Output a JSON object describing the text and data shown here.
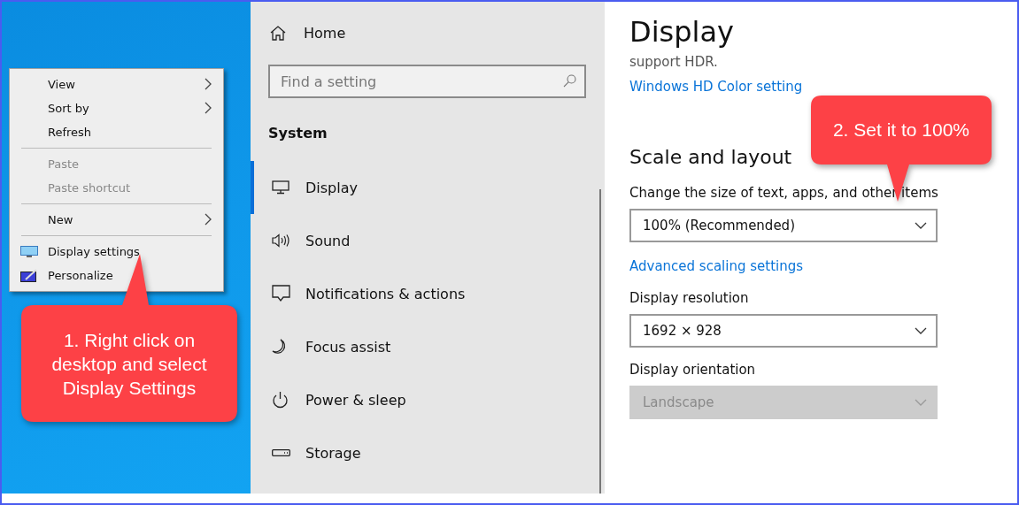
{
  "context_menu": {
    "items": [
      {
        "kind": "item",
        "label": "View",
        "submenu": true,
        "disabled": false
      },
      {
        "kind": "item",
        "label": "Sort by",
        "submenu": true,
        "disabled": false
      },
      {
        "kind": "item",
        "label": "Refresh",
        "submenu": false,
        "disabled": false
      },
      {
        "kind": "separator"
      },
      {
        "kind": "item",
        "label": "Paste",
        "submenu": false,
        "disabled": true
      },
      {
        "kind": "item",
        "label": "Paste shortcut",
        "submenu": false,
        "disabled": true
      },
      {
        "kind": "separator"
      },
      {
        "kind": "item",
        "label": "New",
        "submenu": true,
        "disabled": false
      },
      {
        "kind": "separator"
      },
      {
        "kind": "item",
        "label": "Display settings",
        "submenu": false,
        "disabled": false
      },
      {
        "kind": "item",
        "label": "Personalize",
        "submenu": false,
        "disabled": false
      }
    ]
  },
  "callouts": [
    {
      "text": "1. Right click on desktop and select Display Settings"
    },
    {
      "text": "2. Set it to 100%"
    }
  ],
  "sidebar": {
    "home": "Home",
    "search": {
      "placeholder": "Find a setting"
    },
    "section": "System",
    "items": [
      {
        "label": "Display",
        "selected": true
      },
      {
        "label": "Sound",
        "selected": false
      },
      {
        "label": "Notifications & actions",
        "selected": false
      },
      {
        "label": "Focus assist",
        "selected": false
      },
      {
        "label": "Power & sleep",
        "selected": false
      },
      {
        "label": "Storage",
        "selected": false
      }
    ]
  },
  "content": {
    "title": "Display",
    "hdr_note": "support HDR.",
    "hdr_link": "Windows HD Color setting",
    "section": "Scale and layout",
    "scale": {
      "label": "Change the size of text, apps, and other items",
      "value": "100% (Recommended)",
      "disabled": false
    },
    "advanced_link": "Advanced scaling settings",
    "resolution": {
      "label": "Display resolution",
      "value": "1692 × 928",
      "disabled": false
    },
    "orientation": {
      "label": "Display orientation",
      "value": "Landscape",
      "disabled": true
    }
  }
}
